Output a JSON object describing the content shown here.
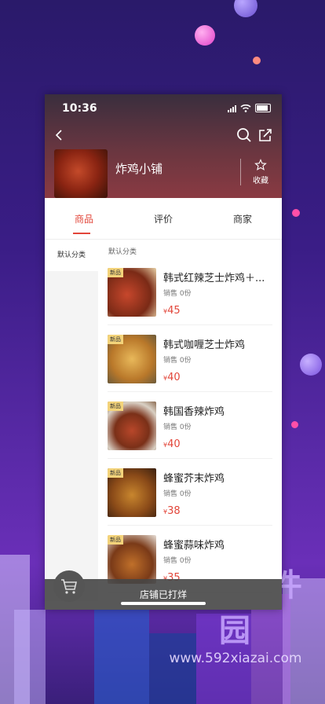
{
  "status": {
    "time": "10:36"
  },
  "shop": {
    "name": "炸鸡小铺",
    "favorite_label": "收藏"
  },
  "tabs": [
    "商品",
    "评价",
    "商家"
  ],
  "sidebar": {
    "items": [
      "默认分类"
    ]
  },
  "category": {
    "title": "默认分类"
  },
  "products": [
    {
      "badge": "新品",
      "title": "韩式红辣芝士炸鸡＋...",
      "sales": "销售 0份",
      "currency": "¥",
      "price": "45"
    },
    {
      "badge": "新品",
      "title": "韩式咖喱芝士炸鸡",
      "sales": "销售 0份",
      "currency": "¥",
      "price": "40"
    },
    {
      "badge": "新品",
      "title": "韩国香辣炸鸡",
      "sales": "销售 0份",
      "currency": "¥",
      "price": "40"
    },
    {
      "badge": "新品",
      "title": "蜂蜜芥末炸鸡",
      "sales": "销售 0份",
      "currency": "¥",
      "price": "38"
    },
    {
      "badge": "新品",
      "title": "蜂蜜蒜味炸鸡",
      "sales": "销售 0份",
      "currency": "¥",
      "price": "35"
    }
  ],
  "bottom_bar": {
    "text": "店铺已打烊"
  },
  "watermark": {
    "brand": "592软件园",
    "url": "www.592xiazai.com"
  },
  "colors": {
    "accent": "#e2463a",
    "badge": "#f3d37a"
  },
  "icons": [
    "back-arrow-icon",
    "search-icon",
    "share-icon",
    "star-icon",
    "cart-icon"
  ]
}
